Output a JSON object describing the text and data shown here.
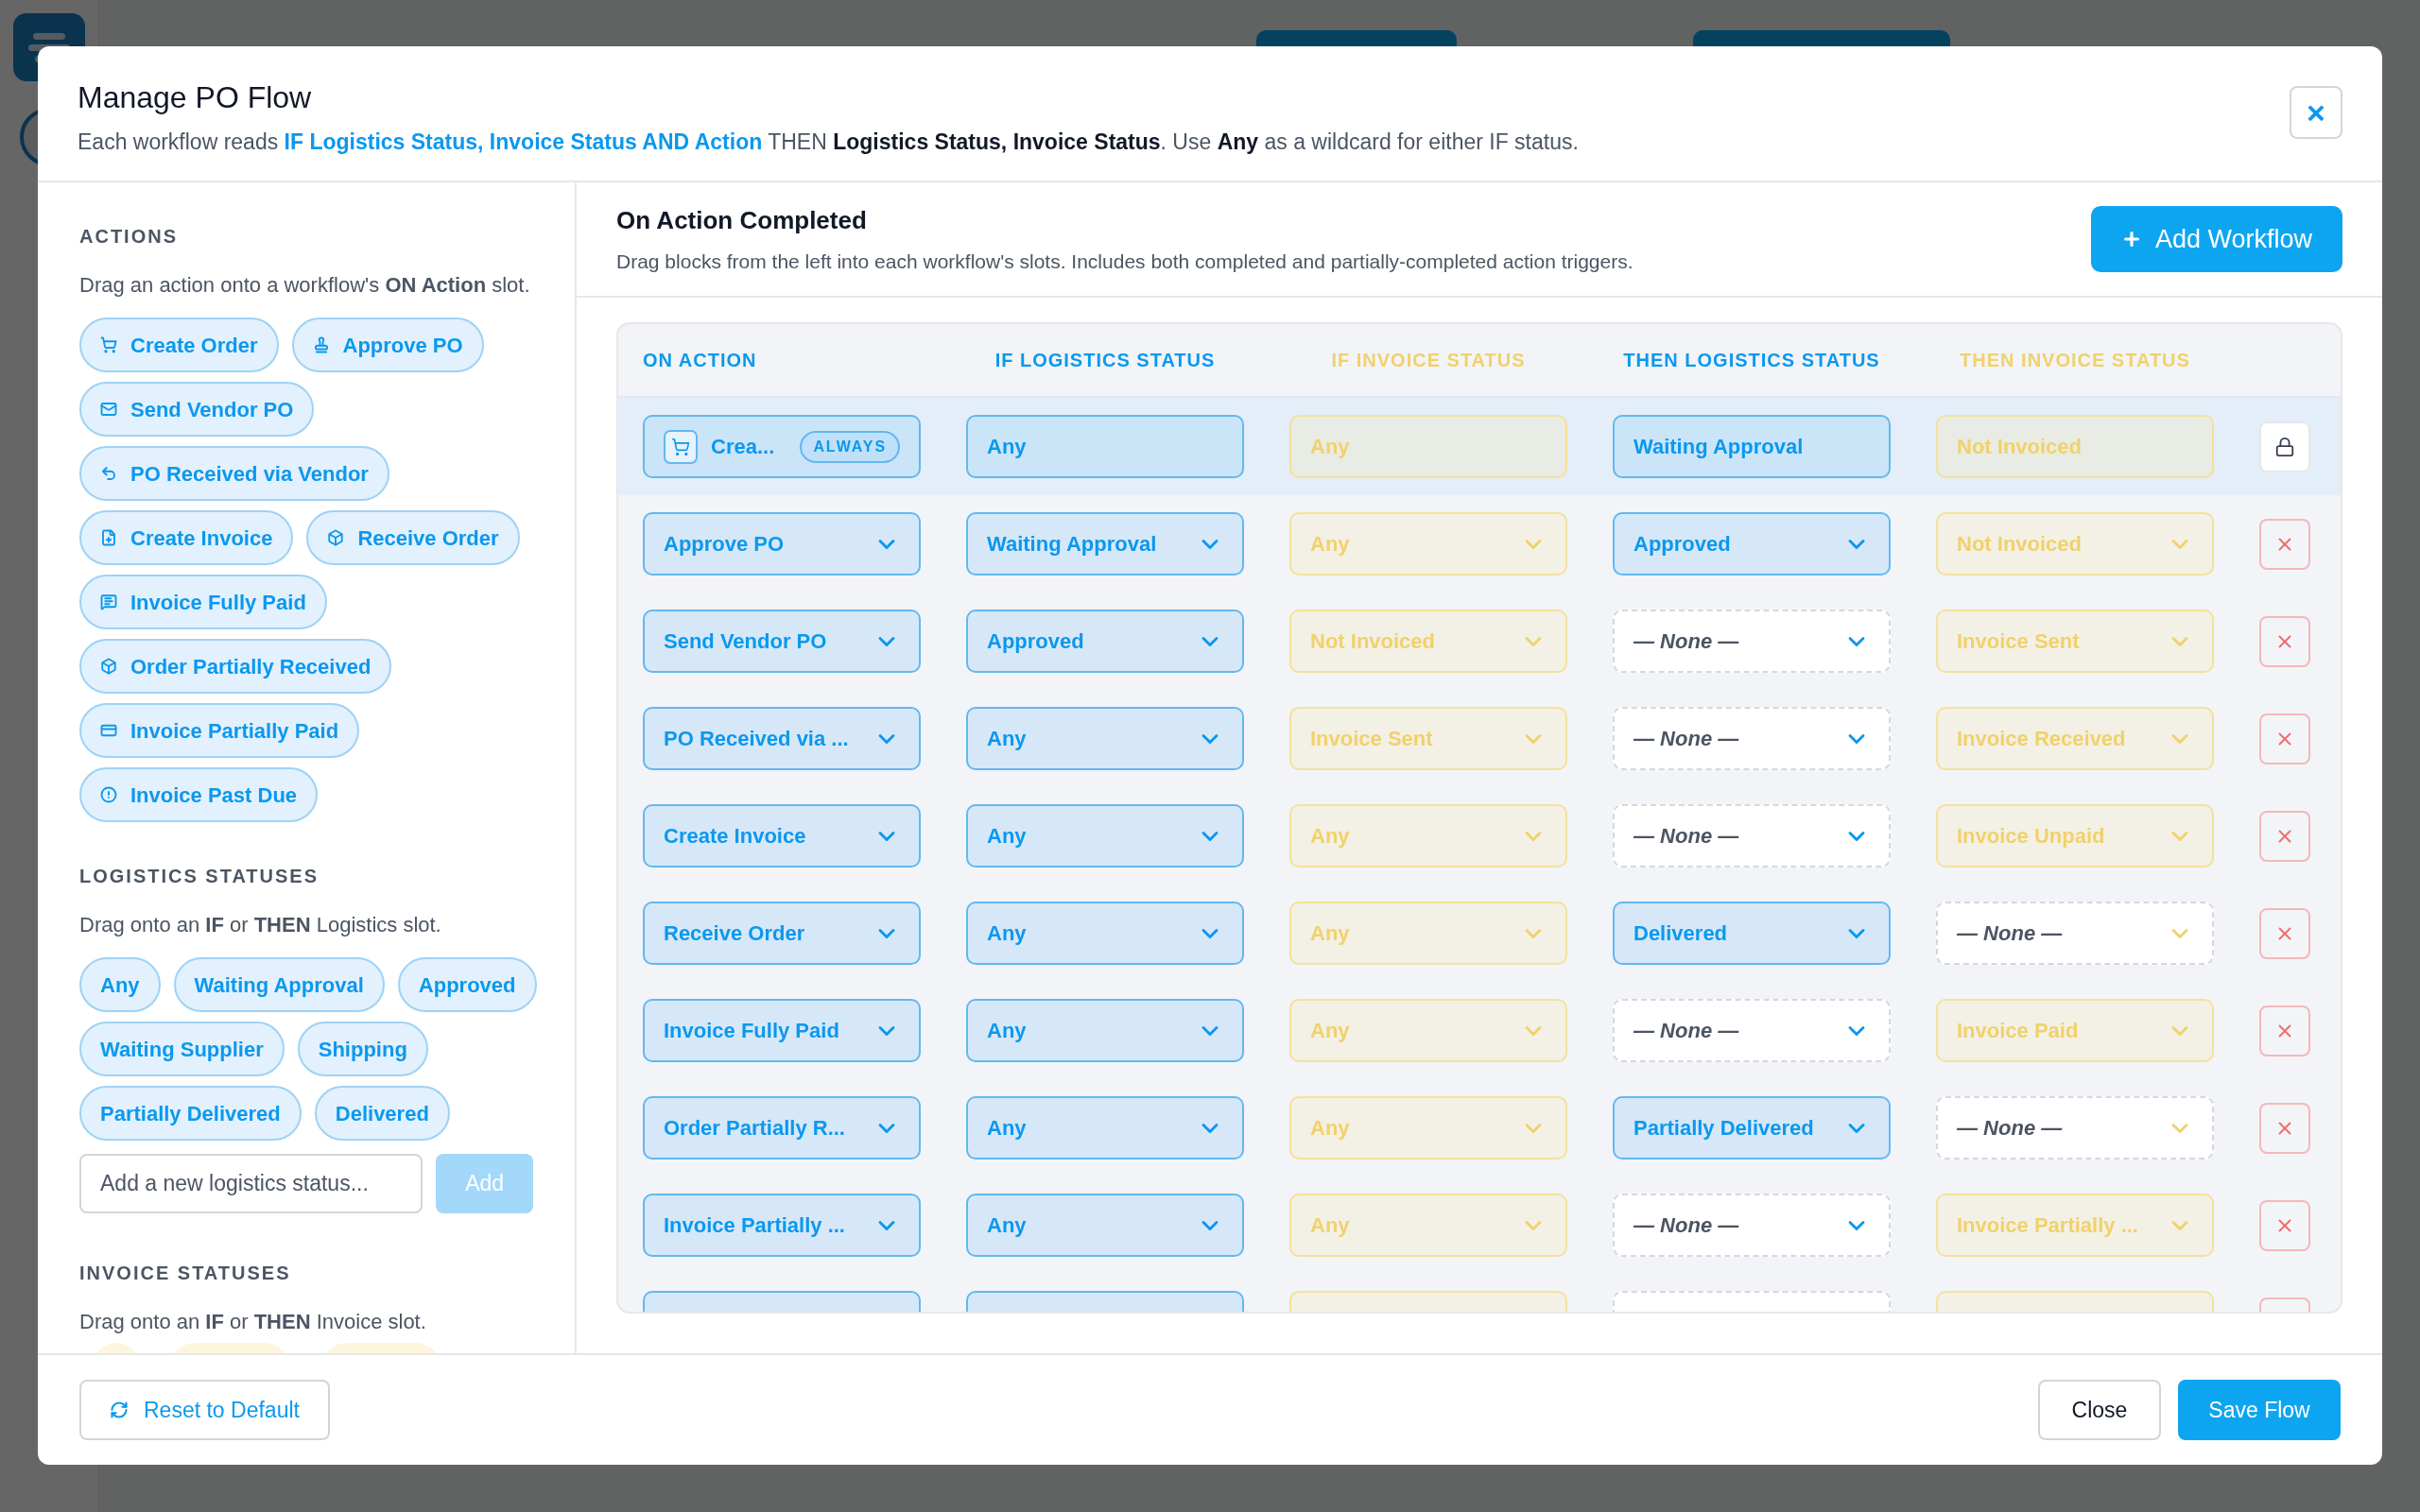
{
  "modal": {
    "title": "Manage PO Flow",
    "description": [
      {
        "kind": "plain",
        "text": "Each workflow reads "
      },
      {
        "kind": "accent",
        "text": "IF Logistics Status, Invoice Status AND Action"
      },
      {
        "kind": "plain",
        "text": " THEN "
      },
      {
        "kind": "bold",
        "text": "Logistics Status, Invoice Status"
      },
      {
        "kind": "plain",
        "text": ". Use "
      },
      {
        "kind": "bold",
        "text": "Any"
      },
      {
        "kind": "plain",
        "text": " as a wildcard for either IF status."
      }
    ],
    "close_label": "×"
  },
  "sidebar": {
    "actions": {
      "heading": "ACTIONS",
      "hint": "Drag an action onto a workflow's **ON Action** slot.",
      "chips": [
        "Create Order",
        "Approve PO",
        "Send Vendor PO",
        "PO Received via Vendor",
        "Create Invoice",
        "Receive Order",
        "Invoice Fully Paid",
        "Order Partially Received",
        "Invoice Partially Paid",
        "Invoice Past Due"
      ]
    },
    "logistics": {
      "heading": "LOGISTICS STATUSES",
      "hint": "Drag onto an **IF** or **THEN** Logistics slot.",
      "chips": [
        "Any",
        "Waiting Approval",
        "Approved",
        "Waiting Supplier",
        "Shipping",
        "Partially Delivered",
        "Delivered"
      ],
      "input": {
        "placeholder": "Add a new logistics status..."
      },
      "add_button": {
        "label": "Add",
        "disabled": true
      }
    },
    "invoice": {
      "heading": "INVOICE STATUSES",
      "hint": "Drag onto an **IF** or **THEN** Invoice slot."
    }
  },
  "panel": {
    "title": "On Action Completed",
    "subtitle": "Drag blocks from the left into each workflow's slots. Includes both completed and partially-completed action triggers.",
    "add_button": "Add Workflow"
  },
  "table": {
    "columns": [
      {
        "label": "ON ACTION",
        "kind": "logistics"
      },
      {
        "label": "IF LOGISTICS STATUS",
        "kind": "logistics"
      },
      {
        "label": "IF INVOICE STATUS",
        "kind": "invoice"
      },
      {
        "label": "THEN LOGISTICS STATUS",
        "kind": "logistics"
      },
      {
        "label": "THEN INVOICE STATUS",
        "kind": "invoice"
      }
    ],
    "rows": [
      {
        "locked": true,
        "badge": "ALWAYS",
        "cells": [
          {
            "value": "Crea..."
          },
          {
            "value": "Any"
          },
          {
            "value": "Any"
          },
          {
            "value": "Waiting Approval"
          },
          {
            "value": "Not Invoiced"
          }
        ]
      },
      {
        "locked": false,
        "cells": [
          {
            "value": "Approve PO"
          },
          {
            "value": "Waiting Approval"
          },
          {
            "value": "Any"
          },
          {
            "value": "Approved"
          },
          {
            "value": "Not Invoiced"
          }
        ]
      },
      {
        "locked": false,
        "cells": [
          {
            "value": "Send Vendor PO"
          },
          {
            "value": "Approved"
          },
          {
            "value": "Not Invoiced"
          },
          {
            "placeholder": "— None —"
          },
          {
            "value": "Invoice Sent"
          }
        ]
      },
      {
        "locked": false,
        "cells": [
          {
            "value": "PO Received via ..."
          },
          {
            "value": "Any"
          },
          {
            "value": "Invoice Sent"
          },
          {
            "placeholder": "— None —"
          },
          {
            "value": "Invoice Received"
          }
        ]
      },
      {
        "locked": false,
        "cells": [
          {
            "value": "Create Invoice"
          },
          {
            "value": "Any"
          },
          {
            "value": "Any"
          },
          {
            "placeholder": "— None —"
          },
          {
            "value": "Invoice Unpaid"
          }
        ]
      },
      {
        "locked": false,
        "cells": [
          {
            "value": "Receive Order"
          },
          {
            "value": "Any"
          },
          {
            "value": "Any"
          },
          {
            "value": "Delivered"
          },
          {
            "placeholder": "— None —"
          }
        ]
      },
      {
        "locked": false,
        "cells": [
          {
            "value": "Invoice Fully Paid"
          },
          {
            "value": "Any"
          },
          {
            "value": "Any"
          },
          {
            "placeholder": "— None —"
          },
          {
            "value": "Invoice Paid"
          }
        ]
      },
      {
        "locked": false,
        "cells": [
          {
            "value": "Order Partially R..."
          },
          {
            "value": "Any"
          },
          {
            "value": "Any"
          },
          {
            "value": "Partially Delivered"
          },
          {
            "placeholder": "— None —"
          }
        ]
      },
      {
        "locked": false,
        "cells": [
          {
            "value": "Invoice Partially ..."
          },
          {
            "value": "Any"
          },
          {
            "value": "Any"
          },
          {
            "placeholder": "— None —"
          },
          {
            "value": "Invoice Partially ..."
          }
        ]
      }
    ]
  },
  "footer": {
    "reset_button": "Reset to Default",
    "close_button": "Close",
    "save_button": "Save Flow"
  }
}
